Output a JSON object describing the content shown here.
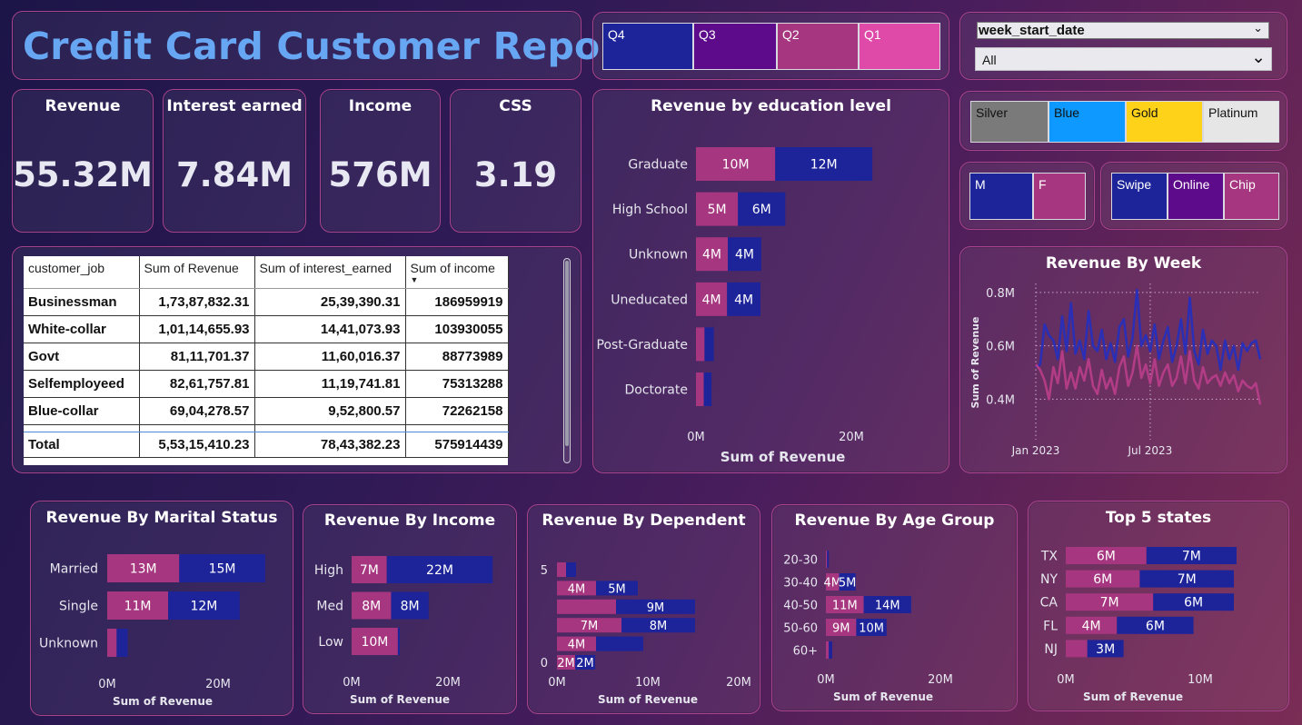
{
  "title": "Credit Card Customer Report",
  "colors": {
    "pink": "#a6367f",
    "blue": "#1d249a",
    "title_blue": "#66a6f2"
  },
  "kpis": [
    {
      "label": "Revenue",
      "value": "55.32M"
    },
    {
      "label": "Interest earned",
      "value": "7.84M"
    },
    {
      "label": "Income",
      "value": "576M"
    },
    {
      "label": "CSS",
      "value": "3.19"
    }
  ],
  "quarter_slicer": [
    {
      "label": "Q4",
      "color": "#1d249a"
    },
    {
      "label": "Q3",
      "color": "#5e0b8b"
    },
    {
      "label": "Q2",
      "color": "#a6367f"
    },
    {
      "label": "Q1",
      "color": "#df4aa9"
    }
  ],
  "date_slicer": {
    "label": "week_start_date",
    "selected": "All"
  },
  "card_slicer": [
    {
      "label": "Silver",
      "color": "#7a7a7a"
    },
    {
      "label": "Blue",
      "color": "#0d99ff"
    },
    {
      "label": "Gold",
      "color": "#ffd21a"
    },
    {
      "label": "Platinum",
      "color": "#e6e6e6"
    }
  ],
  "gender_slicer": [
    {
      "label": "M",
      "color": "#1d249a"
    },
    {
      "label": "F",
      "color": "#a6367f"
    }
  ],
  "txn_slicer": [
    {
      "label": "Swipe",
      "color": "#1d249a"
    },
    {
      "label": "Online",
      "color": "#5e0b8b"
    },
    {
      "label": "Chip",
      "color": "#a6367f"
    }
  ],
  "table": {
    "headers": [
      "customer_job",
      "Sum of Revenue",
      "Sum of interest_earned",
      "Sum of income"
    ],
    "rows": [
      [
        "Businessman",
        "1,73,87,832.31",
        "25,39,390.31",
        "186959919"
      ],
      [
        "White-collar",
        "1,01,14,655.93",
        "14,41,073.93",
        "103930055"
      ],
      [
        "Govt",
        "81,11,701.37",
        "11,60,016.37",
        "88773989"
      ],
      [
        "Selfemployeed",
        "82,61,757.81",
        "11,19,741.81",
        "75313288"
      ],
      [
        "Blue-collar",
        "69,04,278.57",
        "9,52,800.57",
        "72262158"
      ]
    ],
    "total": [
      "Total",
      "5,53,15,410.23",
      "78,43,382.23",
      "575914439"
    ]
  },
  "chart_data": [
    {
      "id": "education",
      "type": "bar",
      "orientation": "horizontal",
      "stacked": true,
      "title": "Revenue by education level",
      "xlabel": "Sum of Revenue",
      "xlim": [
        0,
        20000000
      ],
      "xticks": [
        "0M",
        "20M"
      ],
      "categories": [
        "Graduate",
        "High School",
        "Unknown",
        "Uneducated",
        "Post-Graduate",
        "Doctorate"
      ],
      "series": [
        {
          "color": "#a6367f",
          "values": [
            10200000,
            5400000,
            4100000,
            4000000,
            1100000,
            1000000
          ],
          "labels": [
            "10M",
            "5M",
            "4M",
            "4M",
            "",
            ""
          ]
        },
        {
          "color": "#1d249a",
          "values": [
            12500000,
            6100000,
            4300000,
            4300000,
            1200000,
            1000000
          ],
          "labels": [
            "12M",
            "6M",
            "4M",
            "4M",
            "",
            ""
          ]
        }
      ]
    },
    {
      "id": "week",
      "type": "line",
      "title": "Revenue By Week",
      "ylabel": "Sum of Revenue",
      "ylim": [
        0.33,
        0.82
      ],
      "yticks": [
        [
          "0.8M",
          0.8
        ],
        [
          "0.6M",
          0.6
        ],
        [
          "0.4M",
          0.4
        ]
      ],
      "xticks": [
        [
          "Jan 2023",
          0
        ],
        [
          "Jul 2023",
          26
        ]
      ],
      "grid": true,
      "series": [
        {
          "color": "#2a2fb5",
          "values": [
            0.52,
            0.53,
            0.68,
            0.64,
            0.62,
            0.55,
            0.71,
            0.58,
            0.76,
            0.57,
            0.62,
            0.55,
            0.73,
            0.6,
            0.58,
            0.66,
            0.55,
            0.61,
            0.54,
            0.67,
            0.7,
            0.56,
            0.63,
            0.81,
            0.6,
            0.64,
            0.58,
            0.68,
            0.55,
            0.62,
            0.67,
            0.54,
            0.6,
            0.7,
            0.57,
            0.78,
            0.58,
            0.53,
            0.66,
            0.57,
            0.62,
            0.6,
            0.51,
            0.62,
            0.55,
            0.6,
            0.51,
            0.61,
            0.58,
            0.61,
            0.62,
            0.55
          ]
        },
        {
          "color": "#b23c86",
          "values": [
            0.53,
            0.51,
            0.47,
            0.4,
            0.52,
            0.46,
            0.58,
            0.44,
            0.5,
            0.44,
            0.52,
            0.47,
            0.55,
            0.45,
            0.42,
            0.51,
            0.44,
            0.48,
            0.42,
            0.52,
            0.56,
            0.45,
            0.5,
            0.6,
            0.48,
            0.53,
            0.46,
            0.55,
            0.45,
            0.5,
            0.53,
            0.45,
            0.48,
            0.56,
            0.46,
            0.58,
            0.47,
            0.44,
            0.52,
            0.46,
            0.48,
            0.49,
            0.45,
            0.5,
            0.46,
            0.49,
            0.43,
            0.47,
            0.45,
            0.44,
            0.46,
            0.38
          ]
        }
      ]
    },
    {
      "id": "marital",
      "type": "bar",
      "orientation": "horizontal",
      "stacked": true,
      "title": "Revenue By Marital Status",
      "xlabel": "Sum of Revenue",
      "xlim": [
        0,
        20000000
      ],
      "xticks": [
        "0M",
        "20M"
      ],
      "categories": [
        "Married",
        "Single",
        "Unknown"
      ],
      "series": [
        {
          "color": "#a6367f",
          "values": [
            13000000,
            11000000,
            1700000
          ],
          "labels": [
            "13M",
            "11M",
            ""
          ]
        },
        {
          "color": "#1d249a",
          "values": [
            15500000,
            12900000,
            2000000
          ],
          "labels": [
            "15M",
            "12M",
            ""
          ]
        }
      ]
    },
    {
      "id": "income",
      "type": "bar",
      "orientation": "horizontal",
      "stacked": true,
      "title": "Revenue By Income",
      "xlabel": "Sum of Revenue",
      "xlim": [
        0,
        20000000
      ],
      "xticks": [
        "0M",
        "20M"
      ],
      "categories": [
        "High",
        "Med",
        "Low"
      ],
      "series": [
        {
          "color": "#a6367f",
          "values": [
            7300000,
            8200000,
            9600000
          ],
          "labels": [
            "7M",
            "8M",
            "10M"
          ]
        },
        {
          "color": "#1d249a",
          "values": [
            22000000,
            7800000,
            400000
          ],
          "labels": [
            "22M",
            "8M",
            ""
          ]
        }
      ]
    },
    {
      "id": "dependent",
      "type": "bar",
      "orientation": "horizontal",
      "stacked": true,
      "title": "Revenue By Dependent",
      "xlabel": "Sum of Revenue",
      "xlim": [
        0,
        20000000
      ],
      "xticks": [
        "0M",
        "10M",
        "20M"
      ],
      "categories": [
        "5",
        "4",
        "3",
        "2",
        "1",
        "0"
      ],
      "category_labels": [
        "5",
        "",
        "",
        "",
        "",
        "0"
      ],
      "series": [
        {
          "color": "#a6367f",
          "values": [
            1000000,
            4300000,
            6500000,
            7100000,
            4300000,
            2000000
          ],
          "labels": [
            "",
            "4M",
            "",
            "7M",
            "4M",
            "2M"
          ]
        },
        {
          "color": "#1d249a",
          "values": [
            1100000,
            4600000,
            8700000,
            8100000,
            5200000,
            2200000
          ],
          "labels": [
            "",
            "5M",
            "9M",
            "8M",
            "",
            "2M"
          ]
        }
      ]
    },
    {
      "id": "age",
      "type": "bar",
      "orientation": "horizontal",
      "stacked": true,
      "title": "Revenue By Age Group",
      "xlabel": "Sum of Revenue",
      "xlim": [
        0,
        20000000
      ],
      "xticks": [
        "0M",
        "20M"
      ],
      "categories": [
        "20-30",
        "30-40",
        "40-50",
        "50-60",
        "60+"
      ],
      "series": [
        {
          "color": "#a6367f",
          "values": [
            200000,
            2300000,
            6600000,
            5300000,
            500000
          ],
          "labels": [
            "",
            "4M",
            "11M",
            "9M",
            ""
          ]
        },
        {
          "color": "#1d249a",
          "values": [
            300000,
            2900000,
            8300000,
            5300000,
            600000
          ],
          "labels": [
            "",
            "5M",
            "14M",
            "10M",
            ""
          ]
        }
      ]
    },
    {
      "id": "states",
      "type": "bar",
      "orientation": "horizontal",
      "stacked": true,
      "title": "Top 5 states",
      "xlabel": "Sum of Revenue",
      "xlim": [
        0,
        10000000
      ],
      "xticks": [
        "0M",
        "10M"
      ],
      "categories": [
        "TX",
        "NY",
        "CA",
        "FL",
        "NJ"
      ],
      "series": [
        {
          "color": "#a6367f",
          "values": [
            6000000,
            5500000,
            6500000,
            3800000,
            1600000
          ],
          "labels": [
            "6M",
            "6M",
            "7M",
            "4M",
            ""
          ]
        },
        {
          "color": "#1d249a",
          "values": [
            6700000,
            7000000,
            6000000,
            5700000,
            2700000
          ],
          "labels": [
            "7M",
            "7M",
            "6M",
            "6M",
            "3M"
          ]
        }
      ]
    }
  ]
}
